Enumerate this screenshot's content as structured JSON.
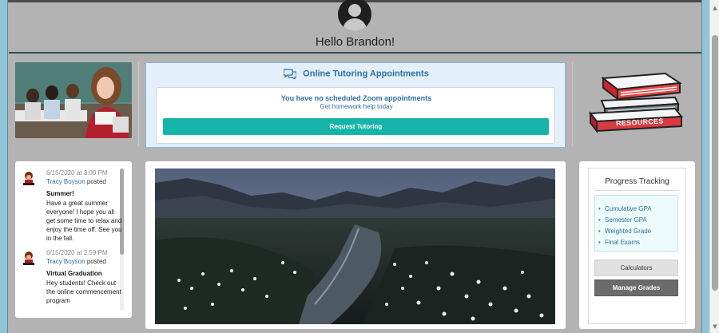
{
  "header": {
    "greeting": "Hello Brandon!",
    "avatar_icon": "user-avatar-icon"
  },
  "tutoring": {
    "title": "Online Tutoring Appointments",
    "icon": "chat-bubbles-icon",
    "status": "You have no scheduled Zoom appointments",
    "help_link": "Get homework help today",
    "request_button": "Request Tutoring",
    "accent_color": "#16b3a8"
  },
  "resources": {
    "label": "RESOURCES"
  },
  "feed": {
    "posts": [
      {
        "timestamp": "6/15/2020 at 3:00 PM",
        "author": "Tracy Boyson",
        "action": "posted",
        "title": "Summer!",
        "body": "Have a great summer everyone! I hope you all get some time to relax and enjoy the time off. See you in the fall."
      },
      {
        "timestamp": "6/15/2020 at 2:59 PM",
        "author": "Tracy Boyson",
        "action": "posted",
        "title": "Virtual Graduation",
        "body": "Hey students! Check out the online commencement program"
      }
    ]
  },
  "progress": {
    "title": "Progress Tracking",
    "links": [
      "Cumulative GPA",
      "Semester GPA",
      "Weighted Grade",
      "Final Exams"
    ],
    "calculators_button": "Calculators",
    "manage_button": "Manage Grades"
  }
}
